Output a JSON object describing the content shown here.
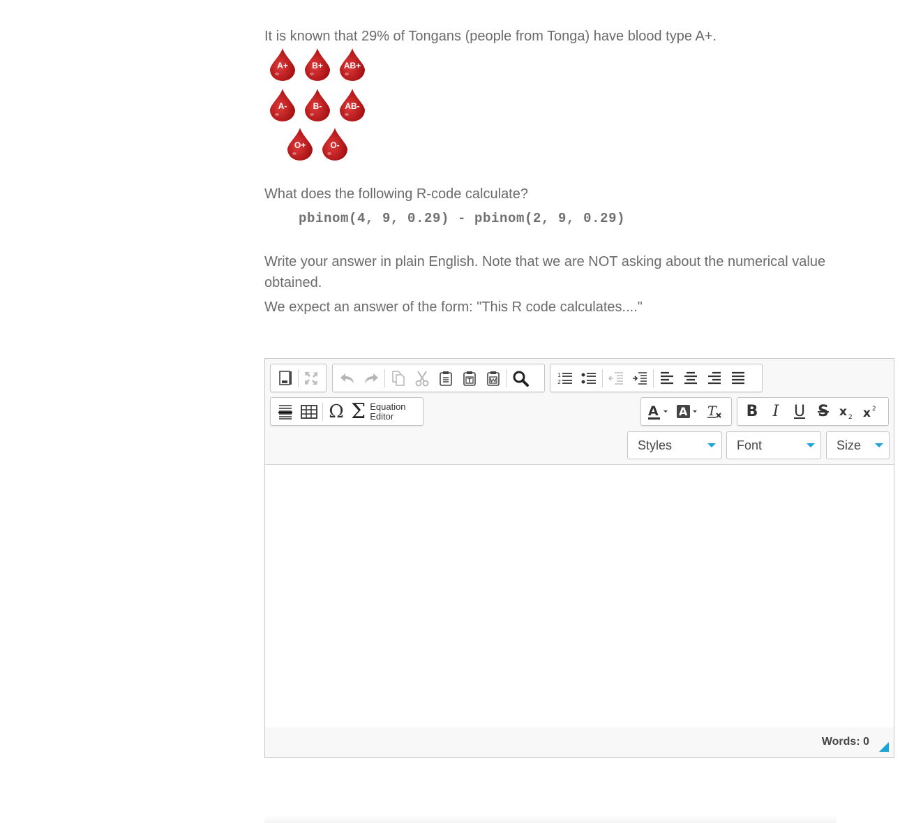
{
  "question": {
    "intro": "It is known that  29% of Tongans (people from Tonga) have blood type A+.",
    "blood_types": [
      "A+",
      "B+",
      "AB+",
      "A-",
      "B-",
      "AB-",
      "O+",
      "O-"
    ],
    "prompt": "What does the following R-code calculate?",
    "code": "pbinom(4, 9, 0.29) - pbinom(2, 9, 0.29)",
    "instruction": "Write your answer in plain English. Note that we are NOT asking about the numerical value obtained.",
    "expected": "We expect an answer of the form: \"This R code calculates....\""
  },
  "editor": {
    "equation_label_1": "Equation",
    "equation_label_2": "Editor",
    "styles_label": "Styles",
    "font_label": "Font",
    "size_label": "Size",
    "words_label": "Words: 0",
    "accent_color": "#1ca3d8",
    "drop_color": "#c3191a",
    "toolbar_icons": [
      "source-icon",
      "maximize-icon",
      "undo-icon",
      "redo-icon",
      "copy-icon",
      "cut-icon",
      "paste-icon",
      "paste-text-icon",
      "paste-word-icon",
      "find-icon",
      "numbered-list-icon",
      "bulleted-list-icon",
      "outdent-icon",
      "indent-icon",
      "align-left-icon",
      "align-center-icon",
      "align-right-icon",
      "justify-icon",
      "horizontal-rule-icon",
      "table-icon",
      "special-char-icon",
      "text-color-icon",
      "background-color-icon",
      "remove-format-icon",
      "bold-icon",
      "italic-icon",
      "underline-icon",
      "strikethrough-icon",
      "subscript-icon",
      "superscript-icon"
    ]
  }
}
